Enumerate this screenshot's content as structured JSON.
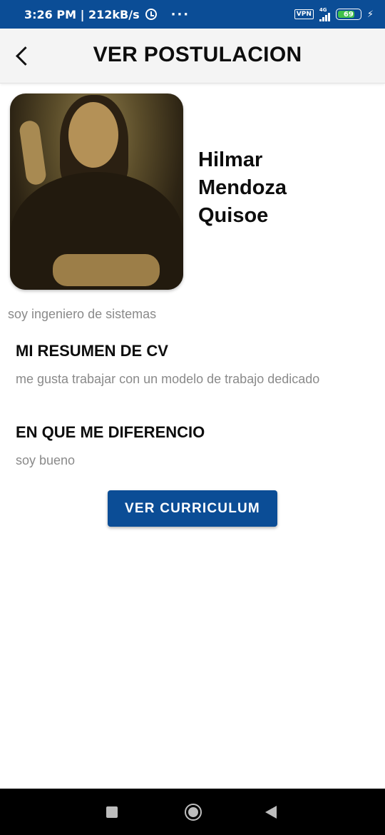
{
  "status_bar": {
    "time_speed": "3:26 PM | 212kB/s",
    "dots": "···",
    "vpn": "VPN",
    "network": "4G",
    "battery": "69"
  },
  "header": {
    "title": "VER POSTULACION"
  },
  "profile": {
    "name_first": "Hilmar",
    "name_last": "Mendoza",
    "name_second_last": "Quisoe",
    "tagline": "soy ingeniero de sistemas"
  },
  "sections": [
    {
      "title": "MI RESUMEN DE CV",
      "text": "me gusta trabajar con un modelo de trabajo dedicado"
    },
    {
      "title": "EN QUE ME DIFERENCIO",
      "text": "soy bueno"
    }
  ],
  "actions": {
    "view_cv_label": "VER CURRICULUM"
  },
  "colors": {
    "primary": "#0b4d96",
    "text_dark": "#0d0d0d",
    "text_muted": "#8a8a8a"
  },
  "icons": {
    "back": "chevron-left-icon",
    "alarm": "alarm-icon",
    "signal": "signal-icon",
    "battery": "battery-icon",
    "charging": "bolt-icon",
    "nav_recent": "square-icon",
    "nav_home": "circle-icon",
    "nav_back": "triangle-icon"
  }
}
